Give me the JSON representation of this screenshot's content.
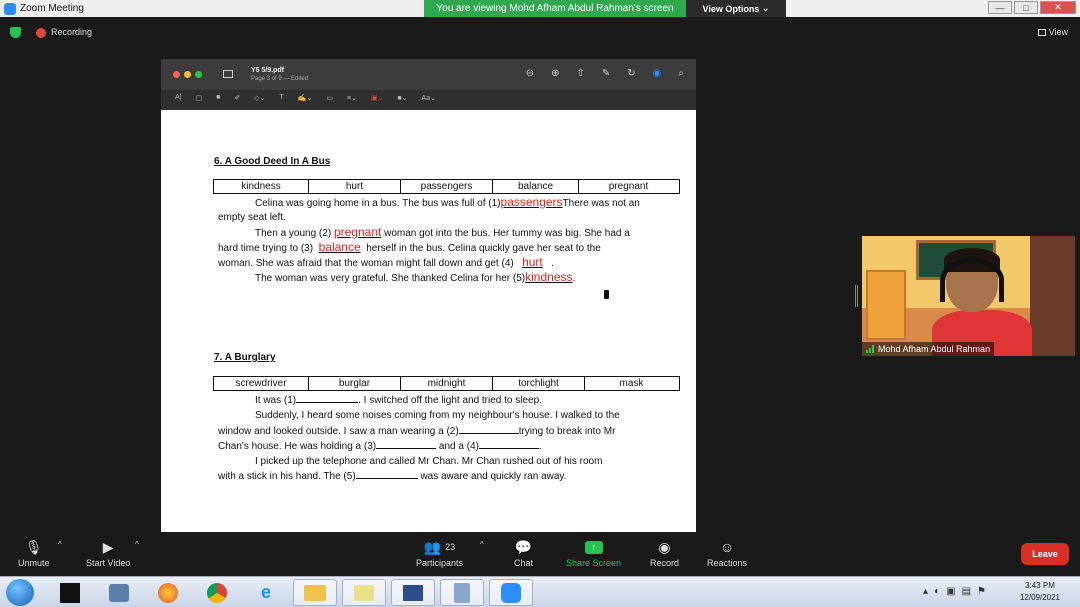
{
  "window": {
    "title": "Zoom Meeting",
    "banner": "You are viewing Mohd Afham Abdul Rahman's screen",
    "view_options": "View Options"
  },
  "status": {
    "recording": "Recording",
    "view": "View"
  },
  "pdf": {
    "filename": "Y5 5/9.pdf",
    "page_info": "Page 3 of 9 — Edited",
    "section6": {
      "title": "6. A Good Deed In A Bus",
      "words": [
        "kindness",
        "hurt",
        "passengers",
        "balance",
        "pregnant"
      ],
      "p1a": "Celina was going home in a bus. The bus was full of (1)",
      "ans1": "passengers",
      "p1b": "There was not an",
      "p1c": "empty seat left.",
      "p2a": "Then a young (2)",
      "ans2": "pregnant",
      "p2b": "woman got into the bus. Her tummy was big. She had a",
      "p2c": "hard time trying to (3)",
      "ans3": "balance",
      "p2d": "herself in the bus. Celina quickly gave her seat to the",
      "p2e": "woman. She was afraid that the woman might fall down and get (4)",
      "ans4": "hurt",
      "p2f": ".",
      "p3a": "The woman was very grateful. She thanked Celina for her (5)",
      "ans5": "kindness",
      "p3b": "."
    },
    "section7": {
      "title": "7. A Burglary",
      "words": [
        "screwdriver",
        "burglar",
        "midnight",
        "torchlight",
        "mask"
      ],
      "l1a": "It was (1)",
      "l1b": ". I switched off the light and tried to sleep.",
      "l2": "Suddenly, I heard some noises coming from my neighbour's house. I walked to the",
      "l3a": "window and looked outside. I saw a man wearing a (2)",
      "l3b": "trying to break into Mr",
      "l4a": "Chan's house. He was holding a (3)",
      "l4b": "and a (4)",
      "l4c": ".",
      "l5": "I picked up the telephone and called Mr Chan. Mr Chan rushed out of his room",
      "l6a": "with a stick in his hand. The (5)",
      "l6b": "was aware and quickly ran away."
    }
  },
  "video": {
    "name": "Mohd Afham Abdul Rahman"
  },
  "controls": {
    "unmute": "Unmute",
    "start_video": "Start Video",
    "participants_count": "23",
    "participants": "Participants",
    "chat": "Chat",
    "share_screen": "Share Screen",
    "record": "Record",
    "reactions": "Reactions",
    "leave": "Leave"
  },
  "taskbar": {
    "time": "3:43 PM",
    "date": "12/09/2021"
  },
  "colors": {
    "banner_green": "#2fa84f",
    "answer_red": "#e0231c",
    "leave_red": "#d93025",
    "share_green": "#23c552"
  }
}
